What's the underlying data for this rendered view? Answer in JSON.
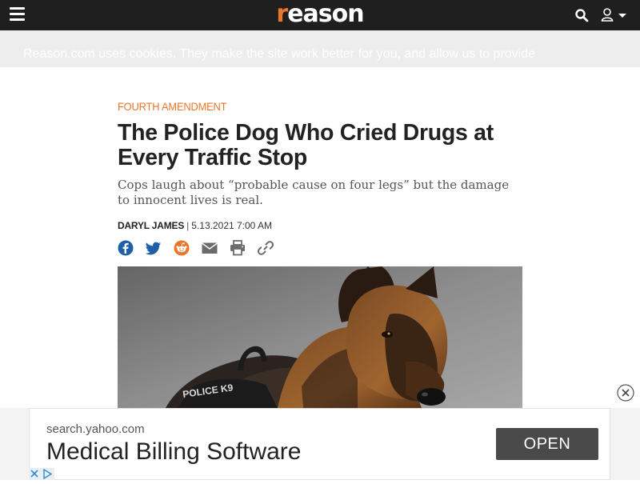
{
  "header": {
    "logo": "reason",
    "logo_first_letter": "r",
    "logo_rest": "eason",
    "accent": "#e8762b",
    "background": "#1f1f1f",
    "icons": [
      "menu-icon",
      "search-icon",
      "user-icon",
      "caret-down-icon"
    ]
  },
  "cookie_banner": {
    "text": "Reason.com uses cookies. They make the site work better for you, and allow us to provide"
  },
  "article": {
    "category": "FOURTH AMENDMENT",
    "title": "The Police Dog Who Cried Drugs at Every Traffic Stop",
    "dek": "Cops laugh about “probable cause on four legs” but the damage to innocent lives is real.",
    "author": "DARYL JAMES",
    "separator": "|",
    "date": "5.13.2021 7:00 AM",
    "share_icons": [
      "facebook-icon",
      "twitter-icon",
      "reddit-icon",
      "email-icon",
      "print-icon",
      "link-icon"
    ],
    "hero_image": {
      "vest_text": "POLICE K9"
    }
  },
  "ad": {
    "domain": "search.yahoo.com",
    "headline": "Medical Billing Software",
    "button": "OPEN"
  }
}
